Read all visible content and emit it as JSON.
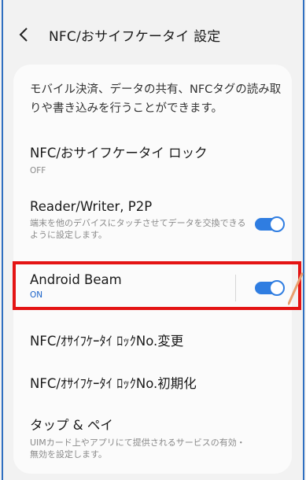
{
  "header": {
    "back_icon": "chevron-left-icon",
    "title": "NFC/おサイフケータイ 設定"
  },
  "description": "モバイル決済、データの共有、NFCタグの読み取りや書き込みを行うことができます。",
  "items": [
    {
      "title": "NFC/おサイフケータイ ロック",
      "status": "OFF"
    },
    {
      "title": "Reader/Writer, P2P",
      "description": "端末を他のデバイスにタッチさせてデータを交換できるように設定します。",
      "toggle_on": true
    },
    {
      "title": "Android Beam",
      "status": "ON",
      "toggle_on": true
    },
    {
      "title": "NFC/ｵｻｲﾌｹｰﾀｲ ﾛｯｸNo.変更"
    },
    {
      "title": "NFC/ｵｻｲﾌｹｰﾀｲ ﾛｯｸNo.初期化"
    },
    {
      "title": "タップ & ペイ",
      "description": "UIMカード上やアプリにて提供されるサービスの有効・無効を設定します。"
    }
  ],
  "colors": {
    "accent": "#2f7de1",
    "on_text": "#1b63c9",
    "highlight": "#e41414",
    "arrow": "#e8a070"
  }
}
